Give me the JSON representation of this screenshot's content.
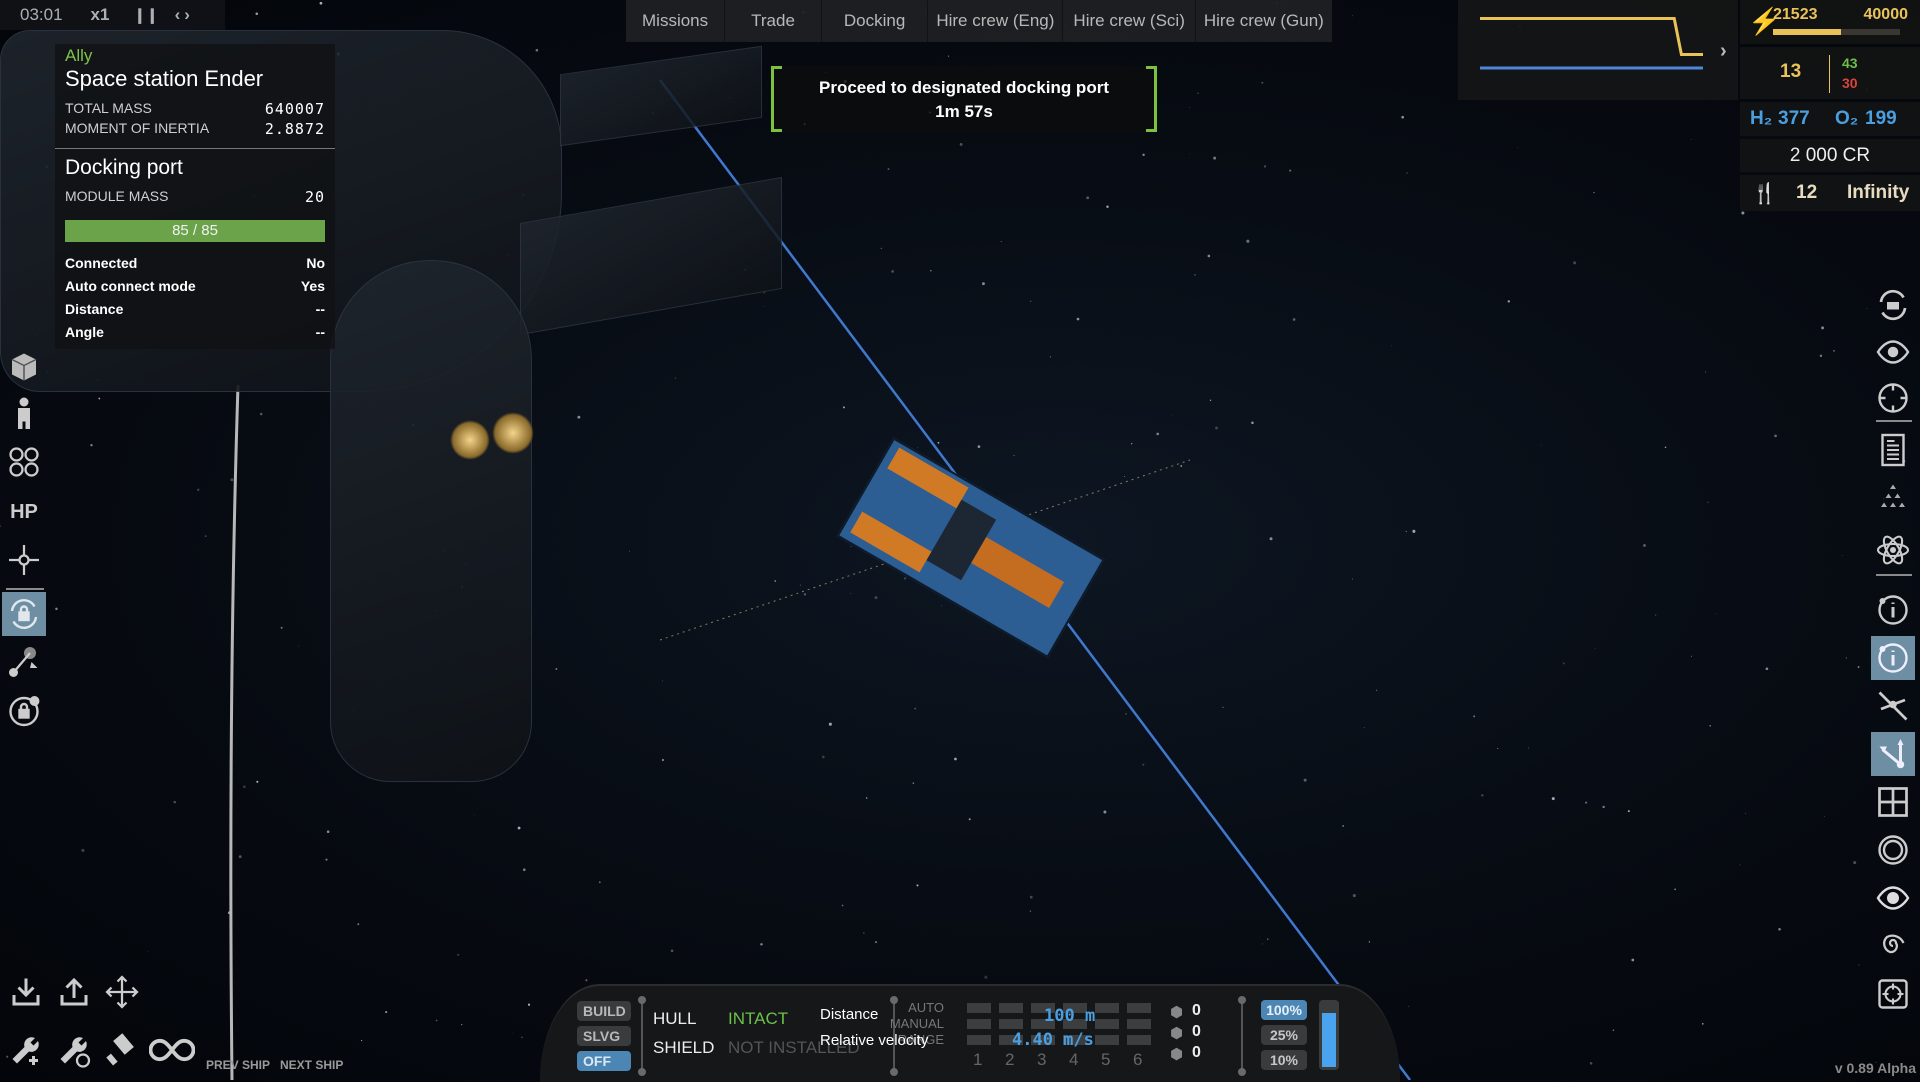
{
  "hud": {
    "time": "03:01",
    "speed": "x1",
    "pause_icon": "pause-icon",
    "step_icons": [
      "step-back-icon",
      "step-forward-icon"
    ],
    "arrows_text": "<->"
  },
  "target": {
    "faction": "Ally",
    "name": "Space station Ender",
    "stats": [
      {
        "label": "TOTAL MASS",
        "value": "640007"
      },
      {
        "label": "MOMENT OF INERTIA",
        "value": "2.8872"
      }
    ],
    "module": {
      "name": "Docking port",
      "mass_label": "MODULE MASS",
      "mass_value": "20",
      "health_text": "85 / 85",
      "health_fraction": 1.0,
      "health_color": "#6aa34a",
      "props": [
        {
          "label": "Connected",
          "value": "No"
        },
        {
          "label": "Auto connect mode",
          "value": "Yes"
        },
        {
          "label": "Distance",
          "value": "--"
        },
        {
          "label": "Angle",
          "value": "--"
        }
      ]
    }
  },
  "tabs": [
    "Missions",
    "Trade",
    "Docking",
    "Hire crew (Eng)",
    "Hire crew (Sci)",
    "Hire crew (Gun)"
  ],
  "objective": {
    "text": "Proceed to designated docking port",
    "timer": "1m 57s",
    "accent": "#7cc23f"
  },
  "graph": {
    "expand_icon": "chevron-right-icon",
    "series": [
      {
        "name": "energy",
        "color": "#e9c25a",
        "values": [
          0.85,
          0.85,
          0.85,
          0.85,
          0.85,
          0.85,
          0.85,
          0.85,
          0.85,
          0.85,
          0.85,
          0.85,
          0.85,
          0.85,
          0.85,
          0.85,
          0.85,
          0.85,
          0.85,
          0.85,
          0.85,
          0.85,
          0.85,
          0.85,
          0.85,
          0.85,
          0.85,
          0.85,
          0.45,
          0.45,
          0.45,
          0.45
        ]
      },
      {
        "name": "other",
        "color": "#4f86d8",
        "values": [
          0.3,
          0.3
        ]
      }
    ]
  },
  "resources": {
    "energy": {
      "icon": "lightning-icon",
      "current": "21523",
      "max": "40000",
      "fraction": 0.538
    },
    "crew": {
      "total": "13",
      "positive": "43",
      "negative": "30"
    },
    "hydrogen": {
      "label": "H₂",
      "value": "377"
    },
    "oxygen": {
      "label": "O₂",
      "value": "199"
    },
    "credits": "2 000 CR",
    "food": {
      "icon": "fork-knife-icon",
      "value": "12",
      "duration": "Infinity"
    }
  },
  "left_toolbar": [
    {
      "name": "cube-icon",
      "active": false
    },
    {
      "name": "crew-person-icon",
      "active": false
    },
    {
      "name": "thrusters-icon",
      "active": false
    },
    {
      "name": "hp-toggle",
      "label": "HP",
      "active": false
    },
    {
      "name": "crosshair-icon",
      "active": false
    },
    {
      "name": "rotation-lock-icon",
      "active": true
    },
    {
      "name": "trajectory-icon",
      "active": false
    },
    {
      "name": "orbit-lock-icon",
      "active": false
    }
  ],
  "right_toolbar": [
    {
      "name": "camera-rotate-icon",
      "active": false
    },
    {
      "name": "eye-icon",
      "active": false
    },
    {
      "name": "target-circle-icon",
      "active": false
    },
    {
      "name": "document-icon",
      "active": false
    },
    {
      "name": "triangles-icon",
      "active": false
    },
    {
      "name": "atom-icon",
      "active": false
    },
    {
      "name": "info-icon",
      "active": false
    },
    {
      "name": "info-active-icon",
      "active": true
    },
    {
      "name": "satellite-icon",
      "active": false
    },
    {
      "name": "vectors-icon",
      "active": true
    },
    {
      "name": "grid-icon",
      "active": false
    },
    {
      "name": "ring-icon",
      "active": false
    },
    {
      "name": "eye-filled-icon",
      "active": false
    },
    {
      "name": "spiral-galaxy-icon",
      "active": false
    },
    {
      "name": "focus-target-icon",
      "active": false
    }
  ],
  "bottom_left_tools": {
    "row1": [
      "download-icon",
      "upload-icon",
      "move-arrows-icon"
    ],
    "row2": [
      "wrench-add-icon",
      "wrench-remove-icon",
      "paint-roller-icon",
      "infinity-icon"
    ],
    "prev_ship": "PREV SHIP",
    "next_ship": "NEXT SHIP"
  },
  "bottom_panel": {
    "modes": [
      {
        "label": "BUILD",
        "active": false
      },
      {
        "label": "SLVG",
        "active": false
      },
      {
        "label": "OFF",
        "active": true
      }
    ],
    "hull_label": "HULL",
    "hull_status": "INTACT",
    "hull_color": "#6cc04a",
    "shield_label": "SHIELD",
    "shield_status": "NOT INSTALLED",
    "distance_label": "Distance",
    "velocity_label": "Relative velocity",
    "distance_value": "100 m",
    "velocity_value": "4.40 m/s",
    "group_rows": [
      "AUTO",
      "MANUAL",
      "RANGE"
    ],
    "group_numbers": [
      "1",
      "2",
      "3",
      "4",
      "5",
      "6"
    ],
    "counters": [
      "0",
      "0",
      "0"
    ],
    "throttle_options": [
      {
        "label": "100%",
        "active": true
      },
      {
        "label": "25%",
        "active": false
      },
      {
        "label": "10%",
        "active": false
      }
    ],
    "throttle_level": 0.85
  },
  "version": "v 0.89 Alpha"
}
